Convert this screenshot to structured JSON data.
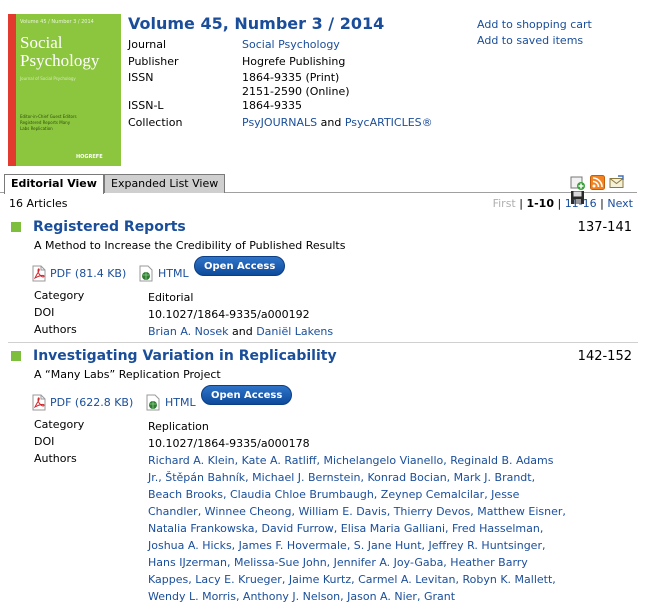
{
  "cover": {
    "top_text": "Volume 45 / Number 3 / 2014",
    "title_line1": "Social",
    "title_line2": "Psychology",
    "mid_text": "Journal of Social Psychology",
    "body_text": "Editor-in-Chief Guest Editors Registered Reports Many Labs Replication",
    "publisher_mark": "HOGREFE"
  },
  "header": {
    "volume_title": "Volume 45, Number 3 / 2014",
    "journal_label": "Journal",
    "journal_value": "Social Psychology",
    "publisher_label": "Publisher",
    "publisher_value": "Hogrefe Publishing",
    "issn_label": "ISSN",
    "issn_print": "1864-9335 (Print)",
    "issn_online": "2151-2590 (Online)",
    "issnl_label": "ISSN-L",
    "issnl_value": "1864-9335",
    "collection_label": "Collection",
    "collection_link1": "PsyJOURNALS",
    "collection_and": " and ",
    "collection_link2": "PsycARTICLES®"
  },
  "actions": {
    "cart": "Add to shopping cart",
    "saved": "Add to saved items"
  },
  "tabs": {
    "editorial": "Editorial View",
    "expanded": "Expanded List View"
  },
  "toolbar_icons": [
    "add-icon",
    "rss-icon",
    "email-icon",
    "save-icon"
  ],
  "list": {
    "count": "16 Articles",
    "pager": {
      "first": "First",
      "sep1": " | ",
      "current": "1-10",
      "sep2": " | ",
      "next_range": "11-16",
      "sep3": " | ",
      "next": "Next"
    }
  },
  "articles": [
    {
      "title": "Registered Reports",
      "pages": "137-141",
      "subtitle": "A Method to Increase the Credibility of Published Results",
      "pdf": "PDF (81.4 KB)",
      "html": "HTML",
      "open_access": "Open Access",
      "category_label": "Category",
      "category": "Editorial",
      "doi_label": "DOI",
      "doi": "10.1027/1864-9335/a000192",
      "authors_label": "Authors",
      "author1": "Brian A. Nosek",
      "authors_and": " and ",
      "author2": "Daniël Lakens"
    },
    {
      "title": "Investigating Variation in Replicability",
      "pages": "142-152",
      "subtitle": "A “Many Labs” Replication Project",
      "pdf": "PDF (622.8 KB)",
      "html": "HTML",
      "open_access": "Open Access",
      "category_label": "Category",
      "category": "Replication",
      "doi_label": "DOI",
      "doi": "10.1027/1864-9335/a000178",
      "authors_label": "Authors",
      "authors_text": "Richard A. Klein, Kate A. Ratliff, Michelangelo Vianello, Reginald B. Adams Jr., Štěpán Bahník, Michael J. Bernstein, Konrad Bocian, Mark J. Brandt, Beach Brooks, Claudia Chloe Brumbaugh, Zeynep Cemalcilar, Jesse Chandler, Winnee Cheong, William E. Davis, Thierry Devos, Matthew Eisner, Natalia Frankowska, David Furrow, Elisa Maria Galliani, Fred Hasselman, Joshua A. Hicks, James F. Hovermale, S. Jane Hunt, Jeffrey R. Huntsinger, Hans IJzerman, Melissa-Sue John, Jennifer A. Joy-Gaba, Heather Barry Kappes, Lacy E. Krueger, Jaime Kurtz, Carmel A. Levitan, Robyn K. Mallett, Wendy L. Morris, Anthony J. Nelson, Jason A. Nier, Grant"
    }
  ],
  "colors": {
    "link": "#1a4e9a",
    "accent_green": "#7dbf3c",
    "open_access_blue": "#1560b8",
    "cover_green": "#8cc63f"
  }
}
